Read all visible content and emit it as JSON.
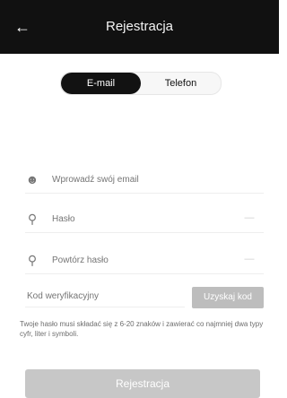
{
  "header": {
    "title": "Rejestracja",
    "back_icon": "arrow-left-icon"
  },
  "tabs": {
    "email_label": "E-mail",
    "phone_label": "Telefon",
    "selected": "E-mail"
  },
  "form": {
    "email": {
      "icon": "user-icon",
      "placeholder": "Wprowadź swój email"
    },
    "password": {
      "icon": "key-icon",
      "placeholder": "Hasło",
      "toggle_icon": "eye-icon"
    },
    "confirm_password": {
      "icon": "key-icon",
      "placeholder": "Powtórz hasło",
      "toggle_icon": "eye-icon"
    },
    "verification_code": {
      "placeholder": "Kod weryfikacyjny",
      "get_code_label": "Uzyskaj kod"
    }
  },
  "hint_text": "Twoje hasło musi składać się z 6-20 znaków i zawierać co najmniej dwa typy cyfr, liter i symboli.",
  "register_button_label": "Rejestracja",
  "colors": {
    "topbar_bg": "#111111",
    "tab_active_bg": "#121212",
    "disabled_button": "#c7c7c7",
    "get_code_button": "#bdbdbd"
  }
}
